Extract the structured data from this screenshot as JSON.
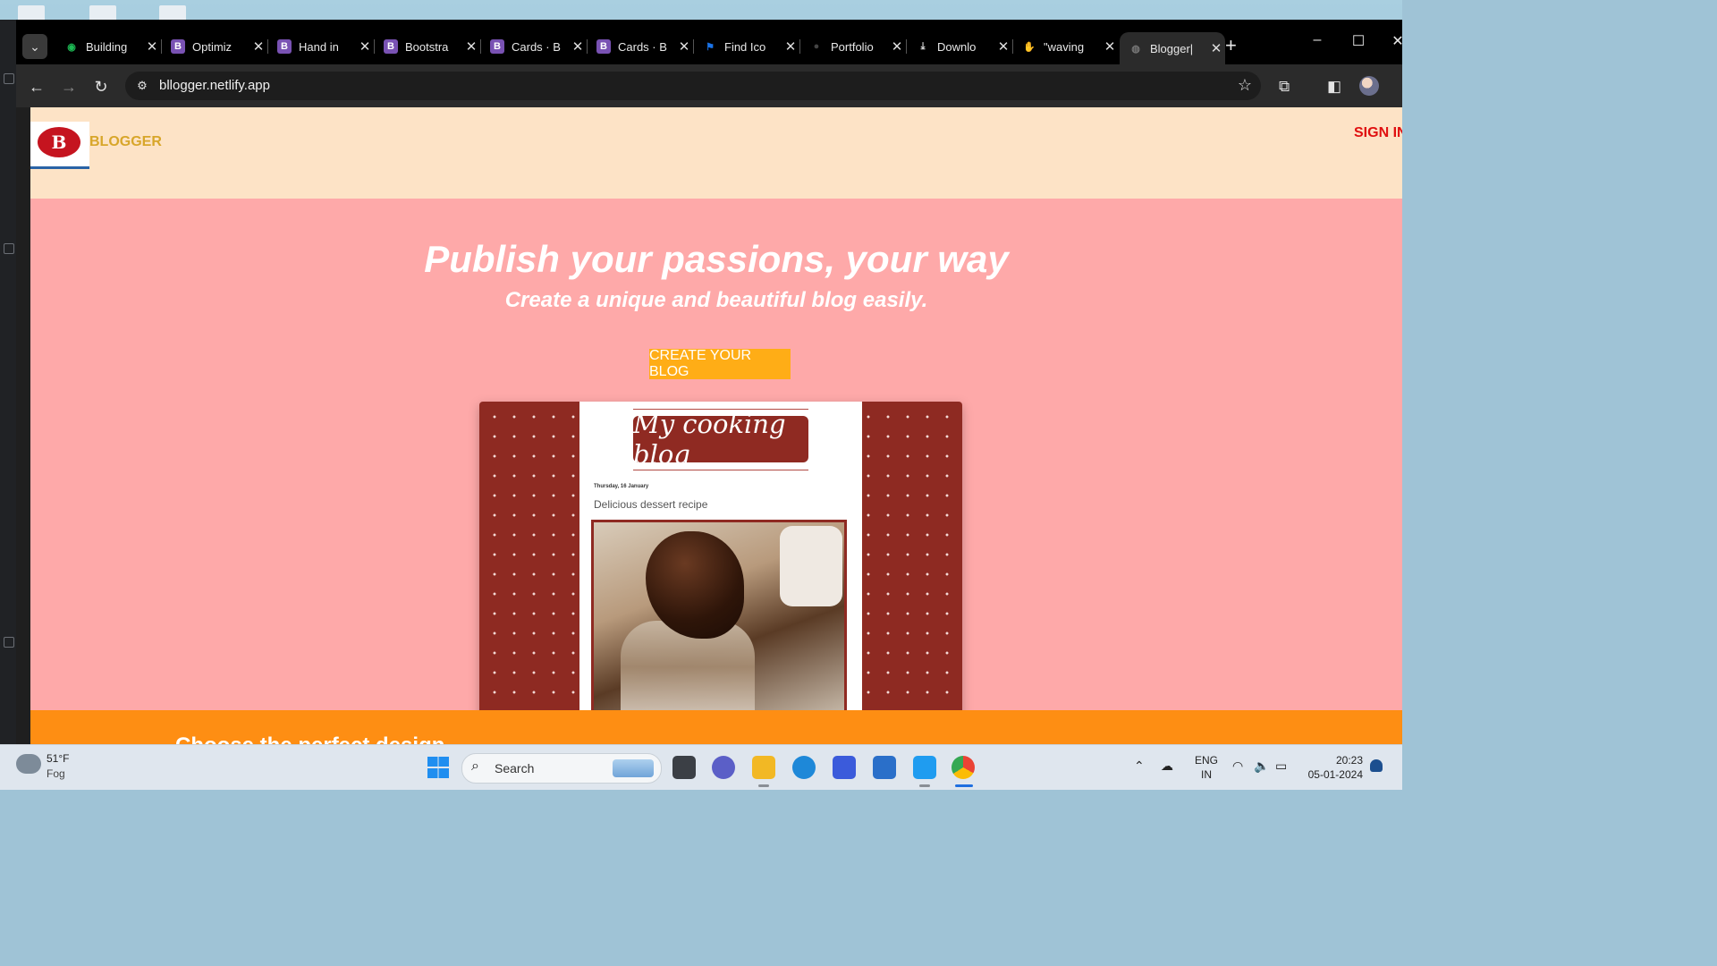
{
  "browser": {
    "tabs": [
      {
        "title": "Building",
        "favicon": "gear-icon",
        "color": "#1db954"
      },
      {
        "title": "Optimiz",
        "favicon": "bootstrap-icon",
        "color": "#7952b3"
      },
      {
        "title": "Hand in",
        "favicon": "bootstrap-icon",
        "color": "#7952b3"
      },
      {
        "title": "Bootstra",
        "favicon": "bootstrap-icon",
        "color": "#7952b3"
      },
      {
        "title": "Cards · B",
        "favicon": "bootstrap-icon",
        "color": "#7952b3"
      },
      {
        "title": "Cards · B",
        "favicon": "bootstrap-icon",
        "color": "#7952b3"
      },
      {
        "title": "Find Ico",
        "favicon": "flag-icon",
        "color": "#1a73e8"
      },
      {
        "title": "Portfolio",
        "favicon": "github-icon",
        "color": "#444444"
      },
      {
        "title": "Downlo",
        "favicon": "download-icon",
        "color": "#dddddd"
      },
      {
        "title": "\"waving",
        "favicon": "emoji-icon",
        "color": "#e89b2a"
      },
      {
        "title": "Blogger|",
        "favicon": "globe-icon",
        "color": "#777777"
      }
    ],
    "active_tab": 10,
    "url": "bllogger.netlify.app"
  },
  "site": {
    "brand": "BLOGGER",
    "logo_letter": "B",
    "sign_in": "SIGN IN",
    "hero_title": "Publish your passions, your way",
    "hero_subtitle": "Create a unique and beautiful blog easily.",
    "cta": "CREATE YOUR BLOG",
    "preview": {
      "blog_title": "My cooking blog",
      "post_date": "Thursday, 16 January",
      "post_title": "Delicious dessert recipe"
    },
    "next_section_title": "Choose the perfect design"
  },
  "taskbar": {
    "weather_temp": "51°F",
    "weather_desc": "Fog",
    "search_label": "Search",
    "language": "ENG",
    "region": "IN",
    "time": "20:23",
    "date": "05-01-2024"
  },
  "colors": {
    "header_bg": "#fde3c6",
    "hero_bg": "#fea9a9",
    "cta_bg": "#ffad16",
    "band_bg": "#fe8e13",
    "brand": "#d8a62a",
    "sign_in": "#e01010"
  }
}
